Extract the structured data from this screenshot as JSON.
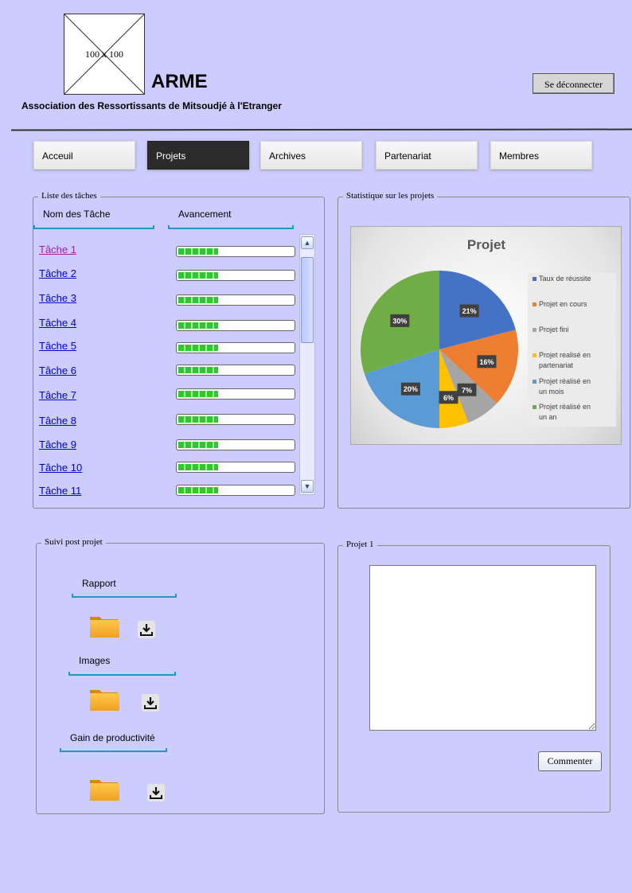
{
  "header": {
    "logo_placeholder": "100 x 100",
    "title": "ARME",
    "subtitle": "Association des Ressortissants de Mitsoudjé à l'Etranger",
    "logout_label": "Se déconnecter"
  },
  "nav": {
    "tabs": [
      {
        "label": "Acceuil",
        "active": false
      },
      {
        "label": "Projets",
        "active": true
      },
      {
        "label": "Archives",
        "active": false
      },
      {
        "label": "Partenariat",
        "active": false
      },
      {
        "label": "Membres",
        "active": false
      }
    ]
  },
  "tasks_panel": {
    "legend": "Liste des tâches",
    "col_name": "Nom des Tâche",
    "col_progress": "Avancement",
    "tasks": [
      {
        "label": "Tâche 1",
        "progress": 0.34
      },
      {
        "label": "Tâche 2",
        "progress": 0.34
      },
      {
        "label": "Tâche 3",
        "progress": 0.34
      },
      {
        "label": "Tâche 4",
        "progress": 0.34
      },
      {
        "label": "Tâche 5",
        "progress": 0.34
      },
      {
        "label": "Tâche 6",
        "progress": 0.34
      },
      {
        "label": "Tâche 7",
        "progress": 0.34
      },
      {
        "label": "Tâche 8",
        "progress": 0.34
      },
      {
        "label": "Tâche 9",
        "progress": 0.34
      },
      {
        "label": "Tâche 10",
        "progress": 0.34
      },
      {
        "label": "Tâche 11",
        "progress": 0.34
      }
    ]
  },
  "stats_panel": {
    "legend": "Statistique sur les projets"
  },
  "chart_data": {
    "type": "pie",
    "title": "Projet",
    "legend_position": "right",
    "categories": [
      "Taux de réussite",
      "Projet en cours",
      "Projet fini",
      "Projet realisé en partenariat",
      "Projet réalisé en un mois",
      "Projet réalisé en un an"
    ],
    "values": [
      21,
      16,
      7,
      6,
      20,
      30
    ],
    "labels": [
      "21%",
      "16%",
      "7%",
      "6%",
      "20%",
      "30%"
    ],
    "colors": [
      "#4472c4",
      "#ed7d31",
      "#a5a5a5",
      "#ffc000",
      "#5b9bd5",
      "#70ad47"
    ]
  },
  "followup_panel": {
    "legend": "Suivi post projet",
    "sections": [
      {
        "title": "Rapport"
      },
      {
        "title": "Images"
      },
      {
        "title": "Gain de productivité"
      }
    ]
  },
  "project_panel": {
    "legend": "Projet 1",
    "comment_label": "Commenter"
  },
  "icons": {
    "folder": "folder-icon",
    "download": "download-icon",
    "scroll_up": "chevron-up-icon",
    "scroll_down": "chevron-down-icon"
  }
}
